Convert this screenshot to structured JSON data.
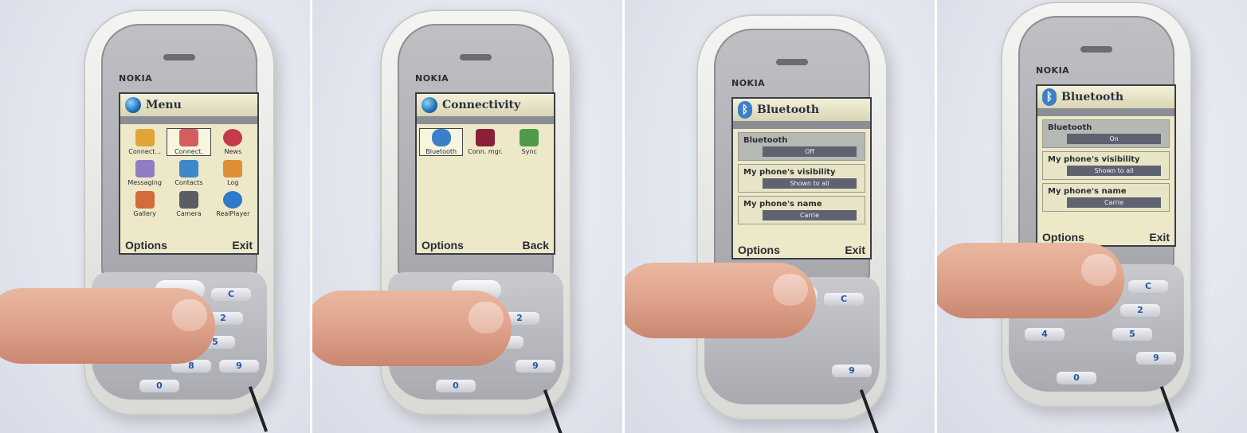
{
  "panels": [
    {
      "brand": "NOKIA",
      "screen_title": "Menu",
      "grid": [
        {
          "label": "Connect...",
          "selected": false,
          "color": "#e0a535"
        },
        {
          "label": "Connect.",
          "selected": true,
          "color": "#d45e5e"
        },
        {
          "label": "News",
          "selected": false,
          "color": "#c33a4a"
        },
        {
          "label": "Messaging",
          "selected": false,
          "color": "#8e7dc3"
        },
        {
          "label": "Contacts",
          "selected": false,
          "color": "#3e88c9"
        },
        {
          "label": "Log",
          "selected": false,
          "color": "#e08e34"
        },
        {
          "label": "Gallery",
          "selected": false,
          "color": "#d46b3a"
        },
        {
          "label": "Camera",
          "selected": false,
          "color": "#5a5d63"
        },
        {
          "label": "RealPlayer",
          "selected": false,
          "color": "#2f79c8"
        }
      ],
      "left_softkey": "Options",
      "right_softkey": "Exit"
    },
    {
      "brand": "NOKIA",
      "screen_title": "Connectivity",
      "grid": [
        {
          "label": "Bluetooth",
          "selected": true,
          "color": "#3a7fc8"
        },
        {
          "label": "Conn. mgr.",
          "selected": false,
          "color": "#8b1f3a"
        },
        {
          "label": "Sync",
          "selected": false,
          "color": "#4f9b4a"
        }
      ],
      "left_softkey": "Options",
      "right_softkey": "Back"
    },
    {
      "brand": "NOKIA",
      "screen_title": "Bluetooth",
      "settings": [
        {
          "label": "Bluetooth",
          "value": "Off",
          "highlighted": true
        },
        {
          "label": "My phone's visibility",
          "value": "Shown to all",
          "highlighted": false
        },
        {
          "label": "My phone's name",
          "value": "Carrie",
          "highlighted": false
        }
      ],
      "left_softkey": "Options",
      "right_softkey": "Exit"
    },
    {
      "brand": "NOKIA",
      "screen_title": "Bluetooth",
      "settings": [
        {
          "label": "Bluetooth",
          "value": "On",
          "highlighted": true
        },
        {
          "label": "My phone's visibility",
          "value": "Shown to all",
          "highlighted": false
        },
        {
          "label": "My phone's name",
          "value": "Carrie",
          "highlighted": false
        }
      ],
      "left_softkey": "Options",
      "right_softkey": "Exit"
    }
  ],
  "keypad_labels": [
    "C",
    "2",
    "4",
    "5",
    "6",
    "8",
    "9",
    "0"
  ]
}
